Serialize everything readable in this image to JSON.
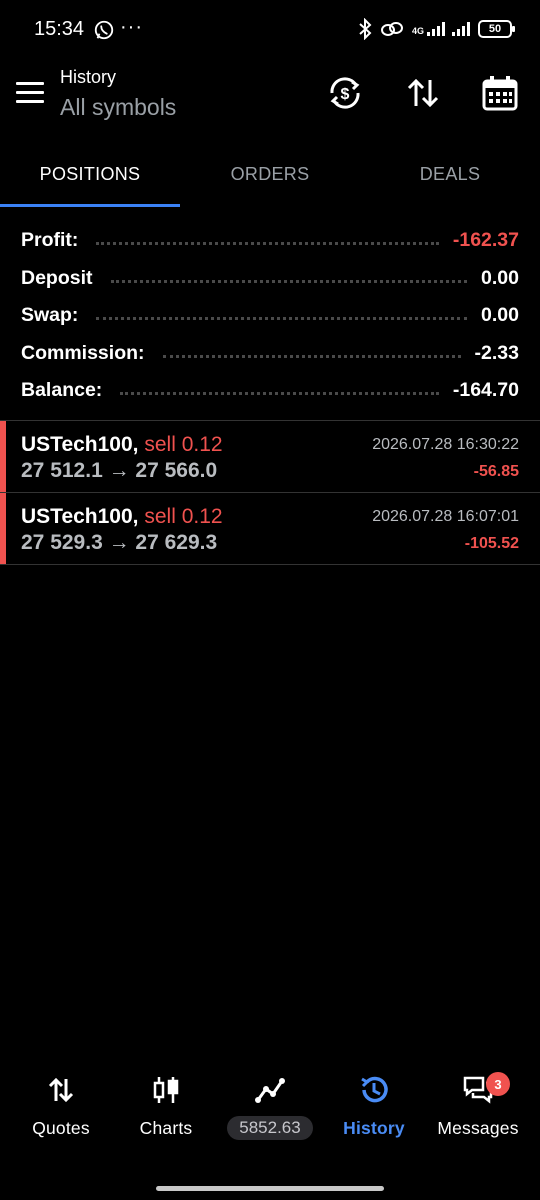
{
  "status_bar": {
    "time": "15:34",
    "dots": "···",
    "network": "4G",
    "battery": "50",
    "icons": [
      "whatsapp-icon",
      "bluetooth-icon",
      "link-icon",
      "signal-icon",
      "battery-icon"
    ]
  },
  "header": {
    "title": "History",
    "subtitle": "All symbols",
    "icons": [
      "menu-icon",
      "currency-sync-icon",
      "sort-icon",
      "calendar-icon"
    ]
  },
  "tabs": [
    {
      "label": "POSITIONS",
      "active": true
    },
    {
      "label": "ORDERS",
      "active": false
    },
    {
      "label": "DEALS",
      "active": false
    }
  ],
  "summary": [
    {
      "label": "Profit:",
      "value": "-162.37",
      "negative": true
    },
    {
      "label": "Deposit",
      "value": "0.00",
      "negative": false
    },
    {
      "label": "Swap:",
      "value": "0.00",
      "negative": false
    },
    {
      "label": "Commission:",
      "value": "-2.33",
      "negative": false
    },
    {
      "label": "Balance:",
      "value": "-164.70",
      "negative": false
    }
  ],
  "positions": [
    {
      "symbol": "USTech100,",
      "side": "sell 0.12",
      "prices": "27 512.1 → 27 566.0",
      "time": "2026.07.28 16:30:22",
      "profit": "-56.85"
    },
    {
      "symbol": "USTech100,",
      "side": "sell 0.12",
      "prices": "27 529.3 → 27 629.3",
      "time": "2026.07.28 16:07:01",
      "profit": "-105.52"
    }
  ],
  "bottom_nav": [
    {
      "label": "Quotes",
      "icon": "quotes-icon",
      "active": false
    },
    {
      "label": "Charts",
      "icon": "charts-icon",
      "active": false
    },
    {
      "label": "5852.63",
      "icon": "trade-icon",
      "active": false
    },
    {
      "label": "History",
      "icon": "history-icon",
      "active": true
    },
    {
      "label": "Messages",
      "icon": "messages-icon",
      "active": false,
      "badge": "3"
    }
  ],
  "colors": {
    "background": "#000000",
    "negative": "#f0524f",
    "accent": "#3b82f6",
    "muted": "#9aa0a6"
  }
}
